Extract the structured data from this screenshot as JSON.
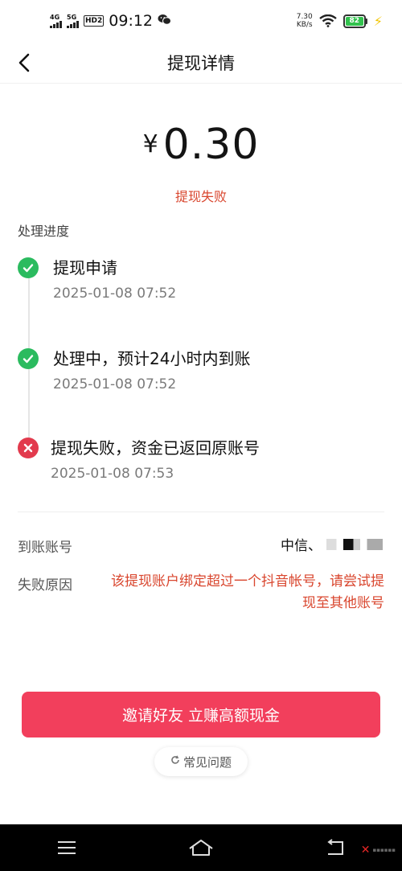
{
  "status_bar": {
    "network1": "4G",
    "network2": "5G",
    "hd": "HD2",
    "time": "09:12",
    "chat_icon": "wechat-icon",
    "speed_value": "7.30",
    "speed_unit": "KB/s",
    "battery": "82",
    "battery_color": "#32c24d"
  },
  "header": {
    "title": "提现详情",
    "back_icon": "chevron-left-icon"
  },
  "amount": {
    "currency": "¥",
    "value": "0.30",
    "status": "提现失败"
  },
  "progress": {
    "label": "处理进度",
    "steps": [
      {
        "title": "提现申请",
        "time": "2025-01-08 07:52",
        "state": "success"
      },
      {
        "title": "处理中，预计24小时内到账",
        "time": "2025-01-08 07:52",
        "state": "success"
      },
      {
        "title": "提现失败，资金已返回原账号",
        "time": "2025-01-08 07:53",
        "state": "failed"
      }
    ]
  },
  "details": {
    "account_label": "到账账号",
    "account_value": "中信、",
    "reason_label": "失败原因",
    "reason_value": "该提现账户绑定超过一个抖音帐号，请尝试提现至其他账号"
  },
  "actions": {
    "invite_button": "邀请好友 立赚高额现金",
    "faq_button": "常见问题"
  },
  "colors": {
    "accent": "#f23f5c",
    "error_text": "#d9462e",
    "success": "#2bbb5f",
    "fail": "#e23a4d"
  },
  "nav": {
    "menu_icon": "menu-icon",
    "home_icon": "home-icon",
    "back_icon": "back-icon"
  }
}
